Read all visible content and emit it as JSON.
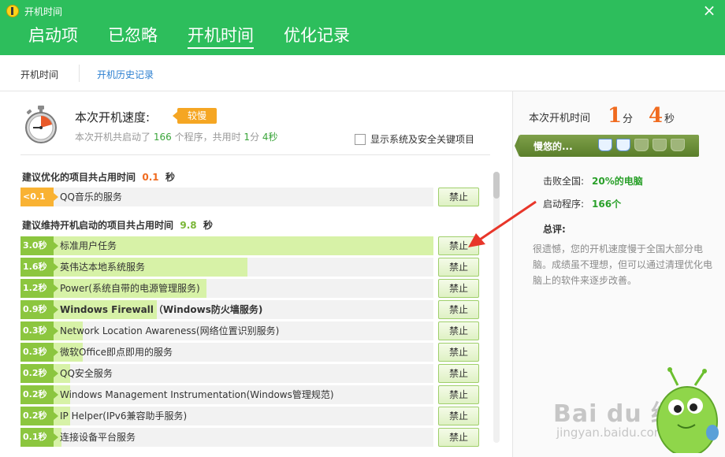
{
  "window": {
    "title": "开机时间"
  },
  "tabs": [
    {
      "label": "启动项"
    },
    {
      "label": "已忽略"
    },
    {
      "label": "开机时间",
      "active": true
    },
    {
      "label": "优化记录"
    }
  ],
  "subnav": {
    "item1": "开机时间",
    "item2": "开机历史记录"
  },
  "speed": {
    "label": "本次开机速度:",
    "badge": "较慢",
    "desc_prefix": "本次开机共启动了",
    "program_count": "166",
    "desc_mid": "个程序，共用时",
    "minutes": "1",
    "min_unit": "分",
    "seconds": "4秒"
  },
  "show_system": {
    "label": "显示系统及安全关键项目",
    "checked": false
  },
  "optimize_section": {
    "label": "建议优化的项目共占用时间",
    "value": "0.1",
    "unit": "秒"
  },
  "keep_section": {
    "label": "建议维持开机启动的项目共占用时间",
    "value": "9.8",
    "unit": "秒"
  },
  "optimize_items": [
    {
      "time": "<0.1秒",
      "name": "QQ音乐的服务",
      "bold": false,
      "fill": 0.0,
      "warn": true,
      "button": "禁止"
    }
  ],
  "keep_items": [
    {
      "time": "3.0秒",
      "name": "标准用户任务",
      "bold": false,
      "fill": 1.0,
      "button": "禁止"
    },
    {
      "time": "1.6秒",
      "name": "英伟达本地系统服务",
      "bold": false,
      "fill": 0.55,
      "button": "禁止"
    },
    {
      "time": "1.2秒",
      "name": "Power(系统自带的电源管理服务)",
      "bold": false,
      "fill": 0.45,
      "button": "禁止"
    },
    {
      "time": "0.9秒",
      "name": "Windows Firewall（Windows防火墙服务)",
      "bold": true,
      "fill": 0.33,
      "button": "禁止"
    },
    {
      "time": "0.3秒",
      "name": "Network Location Awareness(网络位置识别服务)",
      "bold": false,
      "fill": 0.15,
      "button": "禁止"
    },
    {
      "time": "0.3秒",
      "name": "微软Office即点即用的服务",
      "bold": false,
      "fill": 0.15,
      "button": "禁止"
    },
    {
      "time": "0.2秒",
      "name": "QQ安全服务",
      "bold": false,
      "fill": 0.12,
      "button": "禁止"
    },
    {
      "time": "0.2秒",
      "name": "Windows Management Instrumentation(Windows管理规范)",
      "bold": false,
      "fill": 0.12,
      "button": "禁止"
    },
    {
      "time": "0.2秒",
      "name": "IP Helper(IPv6兼容助手服务)",
      "bold": false,
      "fill": 0.12,
      "button": "禁止"
    },
    {
      "time": "0.1秒",
      "name": "连接设备平台服务",
      "bold": false,
      "fill": 0.1,
      "button": "禁止"
    }
  ],
  "side": {
    "time_label": "本次开机时间",
    "minutes": "1",
    "min_unit": "分",
    "seconds": "4",
    "sec_unit": "秒",
    "slow_text": "慢悠的...",
    "cups_on": 2,
    "cups_total": 5,
    "beat_label": "击败全国:",
    "beat_value": "20%的电脑",
    "programs_label": "启动程序:",
    "programs_value": "166个",
    "review_title": "总评:",
    "review_text": "很遗憾，您的开机速度慢于全国大部分电脑。成绩虽不理想，但可以通过清理优化电脑上的软件来逐步改善。"
  },
  "watermark": {
    "line1": "Bai du 经验",
    "line2": "jingyan.baidu.com"
  },
  "colors": {
    "brand_green": "#2dbe5c",
    "accent_orange": "#f06b1f",
    "badge_orange": "#f5a623",
    "time_tag_green": "#8cc63f",
    "bar_fill": "#d7f2a7"
  }
}
